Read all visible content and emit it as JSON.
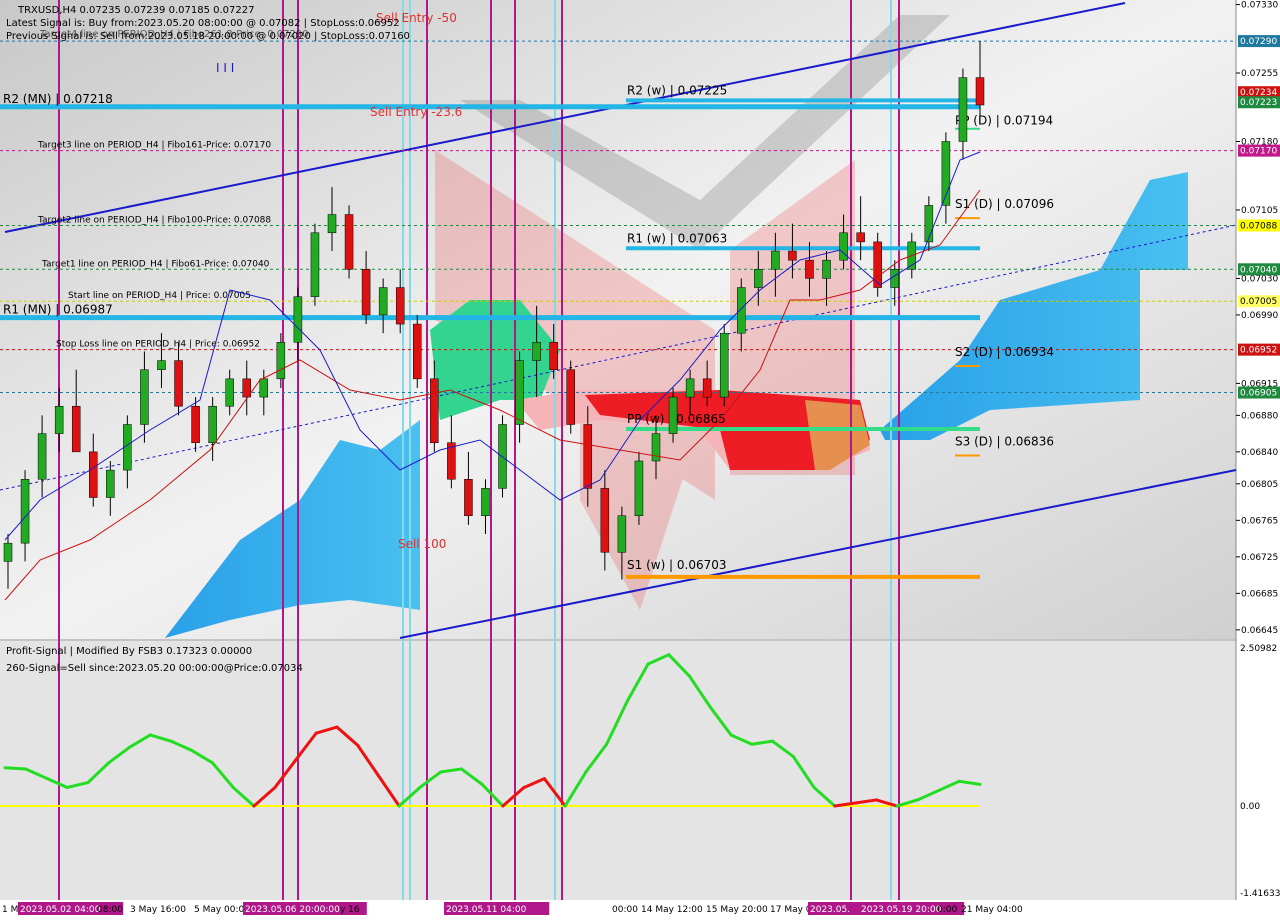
{
  "header": {
    "symbol_line": "TRXUSD,H4  0.07235 0.07239 0.07185 0.07227",
    "latest_signal": "Latest Signal is: Buy from:2023.05.20 08:00:00 @ 0.07082 | StopLoss:0.06952",
    "previous_signal": "Previous Signal is: Sell from:2023.05.18 20:00:00 @ 0.07020 | StopLoss:0.07160",
    "overlap_text": "Target4 line on PERIOD_H4 | Fibo261.8-Price: 0.07290"
  },
  "colors": {
    "bull_candle": "#22aa22",
    "bear_candle": "#dd1111",
    "signal_up": "#22dd22",
    "signal_down": "#ee1111",
    "zero_line": "#ffff00",
    "channel": "#1a1acc",
    "pivot_blue": "#22b5e6",
    "pivot_orange": "#ff9900",
    "pivot_green": "#33dd88",
    "session_line": "#b0188a",
    "session_line_alt": "#87d8e8"
  },
  "price_axis": {
    "ticks": [
      "0.07330",
      "0.07255",
      "0.07180",
      "0.07105",
      "0.07030",
      "0.06990",
      "0.06915",
      "0.06880",
      "0.06840",
      "0.06805",
      "0.06765",
      "0.06725",
      "0.06685",
      "0.06645"
    ],
    "highlights": [
      {
        "label": "0.07290",
        "color": "#1f7a9e",
        "price": 0.0729
      },
      {
        "label": "0.07234",
        "color": "#cc1111",
        "price": 0.07234
      },
      {
        "label": "0.07223",
        "color": "#1f8a3f",
        "price": 0.07223
      },
      {
        "label": "0.07170",
        "color": "#c2188a",
        "price": 0.0717
      },
      {
        "label": "0.07088",
        "color": "#ffff00",
        "price": 0.07088
      },
      {
        "label": "0.07040",
        "color": "#1f8a3f",
        "price": 0.0704
      },
      {
        "label": "0.07005",
        "color": "#ffff66",
        "price": 0.07005
      },
      {
        "label": "0.06952",
        "color": "#cc1111",
        "price": 0.06952
      },
      {
        "label": "0.06905",
        "color": "#1f8a3f",
        "price": 0.06905
      }
    ]
  },
  "time_axis": {
    "labels": [
      "1 M",
      "2023.05.02 04:00",
      "08:00",
      "3 May 16:00",
      "5 May 00:00",
      "2023.05.06 20:00:00",
      "y 16",
      "2023.05.11 04:00",
      "00:00",
      "14 May 12:00",
      "15 May 20:00",
      "17 May 0",
      "2023.05.",
      "2023.05.19 20:00",
      "0:00",
      "21 May 04:00"
    ],
    "highlighted": [
      "2023.05.02 04:00",
      "2023.05.06 20:00:00",
      "2023.05.11 04:00",
      "2023.05.",
      "2023.05.19 20:00"
    ]
  },
  "levels": [
    {
      "label": "R2 (MN) | 0.07218",
      "price": 0.07218,
      "kind": "pivot-mn"
    },
    {
      "label": "R1 (MN) | 0.06987",
      "price": 0.06987,
      "kind": "pivot-mn"
    },
    {
      "label": "R2 (w) | 0.07225",
      "price": 0.07225,
      "kind": "pivot-w"
    },
    {
      "label": "R1 (w) | 0.07063",
      "price": 0.07063,
      "kind": "pivot-w"
    },
    {
      "label": "PP (w) | 0.06865",
      "price": 0.06865,
      "kind": "pivot-w-green"
    },
    {
      "label": "S1 (w) | 0.06703",
      "price": 0.06703,
      "kind": "pivot-w-orange"
    },
    {
      "label": "PP (D) | 0.07194",
      "price": 0.07194,
      "kind": "pivot-d-green"
    },
    {
      "label": "S1 (D) | 0.07096",
      "price": 0.07096,
      "kind": "pivot-d"
    },
    {
      "label": "S2 (D) | 0.06934",
      "price": 0.06934,
      "kind": "pivot-d"
    },
    {
      "label": "S3 (D) | 0.06836",
      "price": 0.06836,
      "kind": "pivot-d"
    }
  ],
  "target_lines": [
    {
      "label": "Target3 line on PERIOD_H4 | Fibo161-Price: 0.07170",
      "price": 0.0717,
      "color": "#c2188a"
    },
    {
      "label": "Target2 line on PERIOD_H4 | Fibo100-Price: 0.07088",
      "price": 0.07088,
      "color": "#1f8a3f"
    },
    {
      "label": "Target1 line on PERIOD_H4 | Fibo61-Price: 0.07040",
      "price": 0.0704,
      "color": "#1f8a3f"
    },
    {
      "label": "Start line on PERIOD_H4 | Price: 0.07005",
      "price": 0.07005,
      "color": "#cccc00"
    },
    {
      "label": "Stop Loss line on PERIOD_H4 | Price: 0.06952",
      "price": 0.06952,
      "color": "#cc1111"
    }
  ],
  "chart_labels": {
    "sell_entry_50": "Sell Entry -50",
    "sell_entry_23": "Sell Entry -23.6",
    "sell_100": "Sell 100",
    "bars_marker": "I I I"
  },
  "indicator": {
    "title": "Profit-Signal | Modified By FSB3 0.17323 0.00000",
    "signal_text": "260-Signal=Sell since:2023.05.20 00:00:00@Price:0.07034",
    "axis_top": "2.50982",
    "axis_zero": "0.00",
    "axis_bottom": "-1.41633"
  },
  "chart_data": {
    "type": "line",
    "title": "",
    "price_range": [
      0.06635,
      0.07335
    ],
    "candles": [
      [
        0.0672,
        0.0675,
        0.0669,
        0.0674
      ],
      [
        0.0674,
        0.0682,
        0.0672,
        0.0681
      ],
      [
        0.0681,
        0.0688,
        0.0679,
        0.0686
      ],
      [
        0.0686,
        0.0691,
        0.0684,
        0.0689
      ],
      [
        0.0689,
        0.0693,
        0.0687,
        0.0684
      ],
      [
        0.0684,
        0.0686,
        0.0678,
        0.0679
      ],
      [
        0.0679,
        0.0683,
        0.0677,
        0.0682
      ],
      [
        0.0682,
        0.0688,
        0.068,
        0.0687
      ],
      [
        0.0687,
        0.0695,
        0.0685,
        0.0693
      ],
      [
        0.0693,
        0.0697,
        0.0691,
        0.0694
      ],
      [
        0.0694,
        0.0696,
        0.0688,
        0.0689
      ],
      [
        0.0689,
        0.069,
        0.0684,
        0.0685
      ],
      [
        0.0685,
        0.069,
        0.0683,
        0.0689
      ],
      [
        0.0689,
        0.0693,
        0.0688,
        0.0692
      ],
      [
        0.0692,
        0.0694,
        0.0688,
        0.069
      ],
      [
        0.069,
        0.0693,
        0.0688,
        0.0692
      ],
      [
        0.0692,
        0.0697,
        0.0691,
        0.0696
      ],
      [
        0.0696,
        0.0702,
        0.0694,
        0.0701
      ],
      [
        0.0701,
        0.0709,
        0.07,
        0.0708
      ],
      [
        0.0708,
        0.0713,
        0.0706,
        0.071
      ],
      [
        0.071,
        0.0711,
        0.0703,
        0.0704
      ],
      [
        0.0704,
        0.0706,
        0.0698,
        0.0699
      ],
      [
        0.0699,
        0.0703,
        0.0697,
        0.0702
      ],
      [
        0.0702,
        0.0704,
        0.0697,
        0.0698
      ],
      [
        0.0698,
        0.0699,
        0.0691,
        0.0692
      ],
      [
        0.0692,
        0.0694,
        0.0684,
        0.0685
      ],
      [
        0.0685,
        0.0688,
        0.068,
        0.0681
      ],
      [
        0.0681,
        0.0684,
        0.0676,
        0.0677
      ],
      [
        0.0677,
        0.0681,
        0.0675,
        0.068
      ],
      [
        0.068,
        0.0688,
        0.0679,
        0.0687
      ],
      [
        0.0687,
        0.0695,
        0.0685,
        0.0694
      ],
      [
        0.0694,
        0.07,
        0.069,
        0.0696
      ],
      [
        0.0696,
        0.0698,
        0.0692,
        0.0693
      ],
      [
        0.0693,
        0.0694,
        0.0686,
        0.0687
      ],
      [
        0.0687,
        0.0689,
        0.0678,
        0.068
      ],
      [
        0.068,
        0.0682,
        0.0671,
        0.0673
      ],
      [
        0.0673,
        0.0678,
        0.067,
        0.0677
      ],
      [
        0.0677,
        0.0684,
        0.0676,
        0.0683
      ],
      [
        0.0683,
        0.0688,
        0.0681,
        0.0686
      ],
      [
        0.0686,
        0.0691,
        0.0685,
        0.069
      ],
      [
        0.069,
        0.0693,
        0.0688,
        0.0692
      ],
      [
        0.0692,
        0.0694,
        0.0689,
        0.069
      ],
      [
        0.069,
        0.0698,
        0.0689,
        0.0697
      ],
      [
        0.0697,
        0.0703,
        0.0695,
        0.0702
      ],
      [
        0.0702,
        0.0706,
        0.07,
        0.0704
      ],
      [
        0.0704,
        0.0708,
        0.0701,
        0.0706
      ],
      [
        0.0706,
        0.0709,
        0.0703,
        0.0705
      ],
      [
        0.0705,
        0.0707,
        0.0701,
        0.0703
      ],
      [
        0.0703,
        0.0706,
        0.07,
        0.0705
      ],
      [
        0.0705,
        0.071,
        0.0704,
        0.0708
      ],
      [
        0.0708,
        0.0712,
        0.0705,
        0.0707
      ],
      [
        0.0707,
        0.0708,
        0.0701,
        0.0702
      ],
      [
        0.0702,
        0.0705,
        0.07,
        0.0704
      ],
      [
        0.0704,
        0.0708,
        0.0703,
        0.0707
      ],
      [
        0.0707,
        0.0712,
        0.0706,
        0.0711
      ],
      [
        0.0711,
        0.0719,
        0.0709,
        0.0718
      ],
      [
        0.0718,
        0.0726,
        0.0716,
        0.0725
      ],
      [
        0.0725,
        0.0729,
        0.072,
        0.0722
      ]
    ],
    "signal": [
      0.62,
      0.6,
      0.45,
      0.3,
      0.38,
      0.7,
      0.95,
      1.15,
      1.05,
      0.9,
      0.7,
      0.3,
      0.0,
      -0.3,
      -0.75,
      -1.2,
      -1.3,
      -1.0,
      -0.5,
      0.0,
      0.3,
      0.55,
      0.6,
      0.35,
      0.0,
      -0.3,
      -0.45,
      0.0,
      0.55,
      1.0,
      1.7,
      2.3,
      2.45,
      2.1,
      1.6,
      1.15,
      1.0,
      1.05,
      0.8,
      0.3,
      0.0,
      -0.05,
      -0.1,
      0.0,
      0.1,
      0.25,
      0.4,
      0.35
    ]
  }
}
